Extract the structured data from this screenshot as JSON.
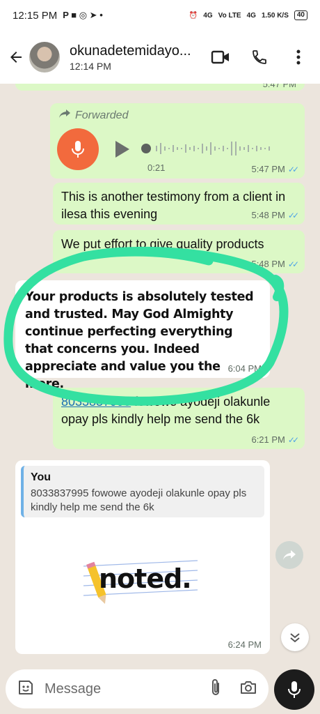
{
  "status_bar": {
    "time": "12:15 PM",
    "left_icons": "P ■ ◎ ➤ •",
    "network1": "4G",
    "network2": "Vo LTE",
    "network3": "4G",
    "speed": "1.50 K/S",
    "battery": "40"
  },
  "header": {
    "contact_name": "okunadetemidayo...",
    "last_seen": "12:14 PM"
  },
  "messages": {
    "top_partial_time": "5:47 PM",
    "voice": {
      "forwarded_label": "Forwarded",
      "duration": "0:21",
      "time": "5:47 PM"
    },
    "m2": {
      "text": "This is another testimony from a client in ilesa this evening",
      "time": "5:48 PM"
    },
    "m3": {
      "text": "We put effort to give quality products",
      "time": "5:48 PM"
    },
    "m4": {
      "text": "Your products is absolutely tested and trusted. May God Almighty continue perfecting everything that concerns you. Indeed appreciate and value you the more.",
      "time": "6:04 PM"
    },
    "m5": {
      "link": "8033837995",
      "text": " fowowe ayodeji olakunle opay pls kindly help me send the 6k",
      "time": "6:21 PM"
    },
    "m6": {
      "quote_author": "You",
      "quote_text": "8033837995 fowowe ayodeji olakunle opay pls kindly help me send the 6k",
      "sticker_text": "noted.",
      "time": "6:24 PM"
    }
  },
  "composer": {
    "placeholder": "Message"
  },
  "colors": {
    "outgoing": "#dcf8c6",
    "incoming": "#ffffff",
    "tick_blue": "#4fa3e6",
    "voice_orange": "#f26a3d",
    "highlight": "#34e0a1"
  }
}
